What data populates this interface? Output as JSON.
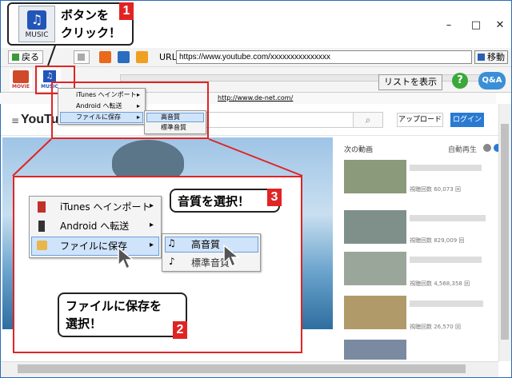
{
  "window": {
    "minimize": "–",
    "maximize": "□",
    "close": "✕"
  },
  "toolbar": {
    "back": "戻る",
    "url_label": "URL",
    "url": "https://www.youtube.com/xxxxxxxxxxxxxxx",
    "go": "移動"
  },
  "toolbar2": {
    "movie_label": "MOVIE",
    "music_label": "MUSIC",
    "list_button": "リストを表示",
    "help": "?",
    "qa": "Q&A"
  },
  "url_strip": "http://www.de-net.com/",
  "callout1": {
    "number": "1",
    "text": "ボタンを\nクリック！",
    "icon_label": "MUSIC"
  },
  "callout2": {
    "number": "2",
    "text": "ファイルに保存を\n選択！"
  },
  "callout3": {
    "number": "3",
    "text": "音質を選択！"
  },
  "menu": {
    "items": [
      "iTunes へインポート",
      "Android へ転送",
      "ファイルに保存"
    ],
    "submenu": [
      "高音質",
      "標準音質"
    ]
  },
  "youtube": {
    "logo": "YouTube",
    "upload": "アップロード",
    "login": "ログイン",
    "next_title": "次の動画",
    "autoplay": "自動再生",
    "views": [
      "視聴回数 60,073 回",
      "視聴回数 829,009 回",
      "視聴回数 4,568,358 回",
      "視聴回数 26,570 回"
    ]
  },
  "colors": {
    "accent_red": "#e02424",
    "menu_highlight": "#cfe3fa",
    "youtube_blue": "#2a7ad2"
  }
}
